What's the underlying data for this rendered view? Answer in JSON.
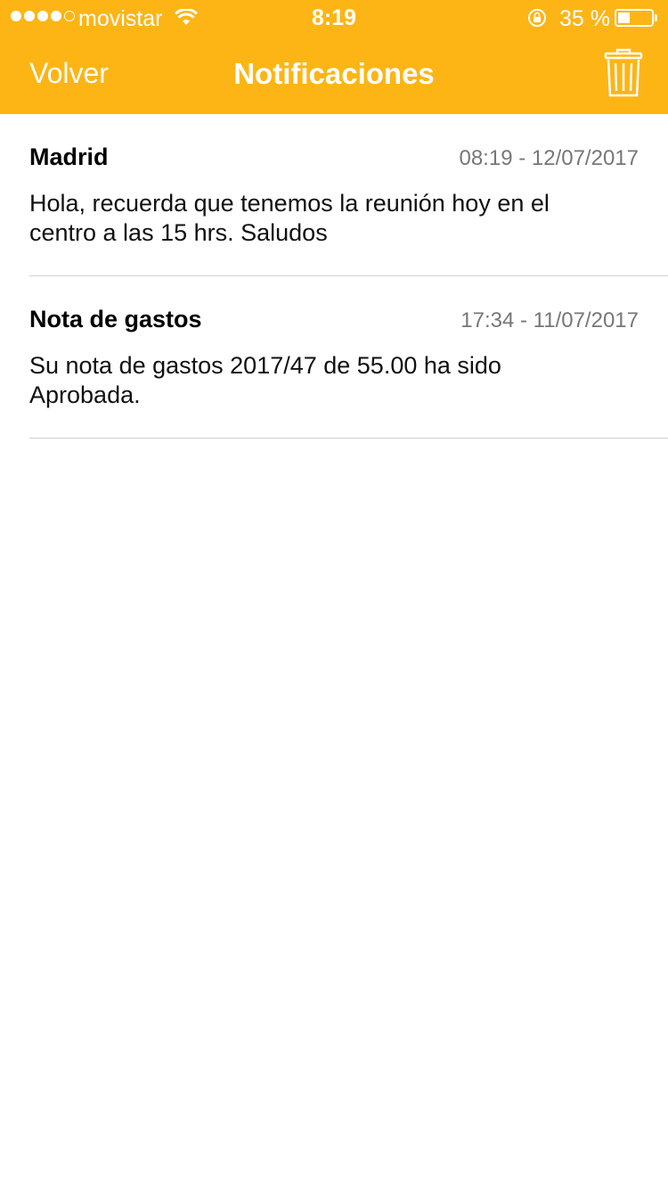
{
  "status_bar": {
    "carrier": "movistar",
    "time": "8:19",
    "battery_percent": "35 %",
    "battery_level": 0.35,
    "signal_bars": 4,
    "signal_total": 5
  },
  "nav": {
    "back_label": "Volver",
    "title": "Notificaciones",
    "trash_icon": "trash-icon"
  },
  "notifications": [
    {
      "title": "Madrid",
      "datetime": "08:19 - 12/07/2017",
      "body": "Hola, recuerda que tenemos la reunión hoy en el centro a las 15 hrs. Saludos"
    },
    {
      "title": "Nota de gastos",
      "datetime": "17:34 - 11/07/2017",
      "body": "Su nota de gastos 2017/47 de 55.00 ha sido Aprobada."
    }
  ],
  "colors": {
    "accent": "#FDB515",
    "separator": "#CFCFCF",
    "date_text": "#777777"
  }
}
